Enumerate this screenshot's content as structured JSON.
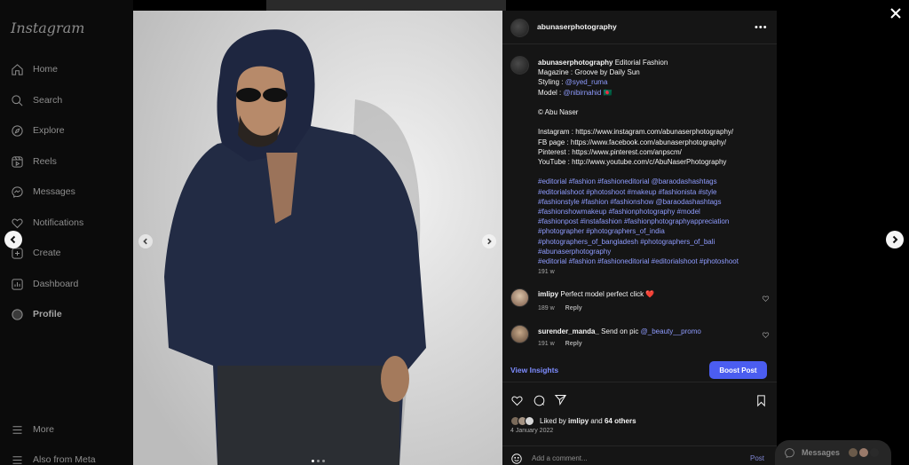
{
  "sidebar": {
    "logo": "Instagram",
    "items": [
      {
        "label": "Home",
        "icon": "home-icon"
      },
      {
        "label": "Search",
        "icon": "search-icon"
      },
      {
        "label": "Explore",
        "icon": "compass-icon"
      },
      {
        "label": "Reels",
        "icon": "reels-icon"
      },
      {
        "label": "Messages",
        "icon": "messenger-icon"
      },
      {
        "label": "Notifications",
        "icon": "heart-icon"
      },
      {
        "label": "Create",
        "icon": "plus-square-icon"
      },
      {
        "label": "Dashboard",
        "icon": "chart-icon"
      },
      {
        "label": "Profile",
        "icon": "avatar-icon"
      }
    ],
    "more": "More",
    "also_from_meta": "Also from Meta"
  },
  "post": {
    "username": "abunaserphotography",
    "caption": {
      "username": "abunaserphotography",
      "line1": "Editorial Fashion",
      "line2": "Magazine : Groove by Daily Sun",
      "styling_label": "Styling :",
      "styling_mention": "@syed_ruma",
      "model_label": "Model :",
      "model_mention": "@nibirnahid",
      "model_flag": "🇧🇩",
      "copyright": "© Abu Naser",
      "instagram": "Instagram : https://www.instagram.com/abunaserphotography/",
      "fb": "FB page : https://www.facebook.com/abunaserphotography/",
      "pinterest": "Pinterest : https://www.pinterest.com/anpscm/",
      "youtube": "YouTube : http://www.youtube.com/c/AbuNaserPhotography",
      "hashtags": [
        "#editorial #fashion #fashioneditorial @baraodashashtags",
        "#editorialshoot #photoshoot #makeup #fashionista #style",
        "#fashionstyle #fashion #fashionshow @baraodashashtags",
        "#fashionshowmakeup #fashionphotography #model",
        "#fashionpost #instafashion #fashionphotographyappreciation",
        "#photographer #photographers_of_india",
        "#photographers_of_bangladesh #photographers_of_bali",
        "#abunaserphotography",
        "#editorial #fashion #fashioneditorial #editorialshoot #photoshoot"
      ],
      "time": "191 w"
    },
    "comments": [
      {
        "user": "imlipy",
        "text": "Perfect model perfect click",
        "emoji": "❤️",
        "mention": "",
        "time": "189 w",
        "reply": "Reply"
      },
      {
        "user": "surender_manda_",
        "text": "Send on pic",
        "emoji": "",
        "mention": "@_beauty__promo",
        "time": "191 w",
        "reply": "Reply"
      }
    ],
    "view_insights": "View Insights",
    "boost_post": "Boost Post",
    "liked_by_prefix": "Liked by",
    "liked_by_user": "imlipy",
    "liked_by_and": "and",
    "liked_by_count": "64 others",
    "date": "4 January 2022",
    "add_comment_placeholder": "Add a comment...",
    "post_button": "Post"
  },
  "messages_bar": {
    "label": "Messages"
  },
  "colors": {
    "accent": "#4b5df0",
    "link": "#8f9cff",
    "panel": "#151515"
  }
}
